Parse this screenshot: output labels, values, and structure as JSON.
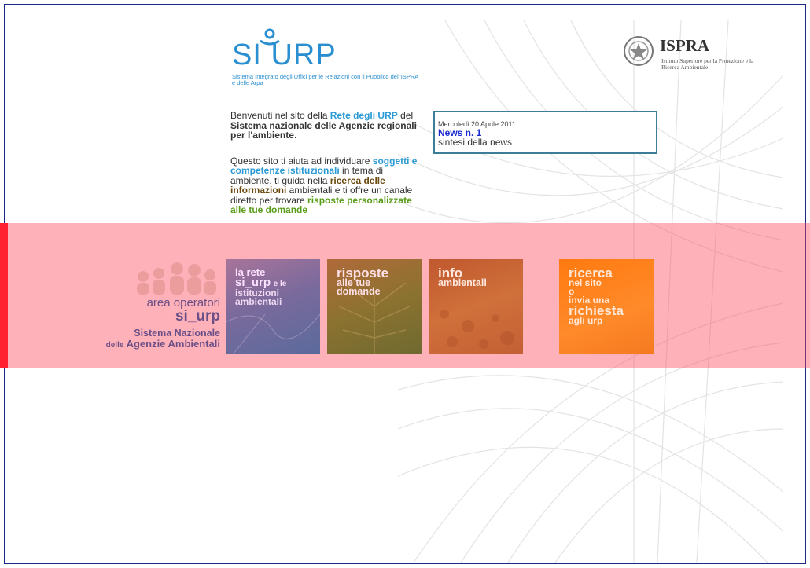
{
  "header": {
    "logo_word": "SI URP",
    "logo_subtitle": "Sistema Integrato degli Uffici per le Relazioni con il Pubblico dell'ISPRA e delle Arpa",
    "ispra_word": "ISPRA",
    "ispra_subtitle": "Istituto Superiore per la Protezione e la Ricerca Ambientale"
  },
  "intro": {
    "p1_a": "Benvenuti nel sito della ",
    "p1_b": "Rete degli URP",
    "p1_c": " del ",
    "p1_d": "Sistema nazionale delle Agenzie regionali per l'ambiente",
    "p1_e": ".",
    "p2_a": "Questo sito ti aiuta ad individuare ",
    "p2_b": "soggetti e competenze istituzionali",
    "p2_c": " in tema di ambiente, ti guida nella ",
    "p2_d": "ricerca delle informazioni",
    "p2_e": " ambientali e ti offre un canale diretto per trovare ",
    "p2_f": "risposte personalizzate alle tue domande"
  },
  "news": {
    "date": "Mercoledì 20 Aprile 2011",
    "title": "News n. 1",
    "summary": "sintesi della news"
  },
  "operatori": {
    "line1": "area operatori",
    "line2": "si_urp",
    "line3": "Sistema Nazionale",
    "line4_small": "delle",
    "line4_big": "Agenzie Ambientali"
  },
  "tiles": {
    "rete": {
      "l1": "la rete",
      "l2": "si_urp",
      "l2b": "e le",
      "l3": "istituzioni",
      "l4": "ambientali"
    },
    "risposte": {
      "l1": "risposte",
      "l2": "alle tue",
      "l3": "domande"
    },
    "info": {
      "l1": "info",
      "l2": "ambientali"
    },
    "ricerca": {
      "l1": "ricerca",
      "l2": "nel sito",
      "l3": "o",
      "l4": "invia una",
      "l5": "richiesta",
      "l6": "agli urp"
    }
  },
  "colors": {
    "accent_blue": "#2a9ad4",
    "band_pink": "#ff6a7a",
    "band_edge": "#ff2030",
    "news_border": "#3b7e96"
  }
}
